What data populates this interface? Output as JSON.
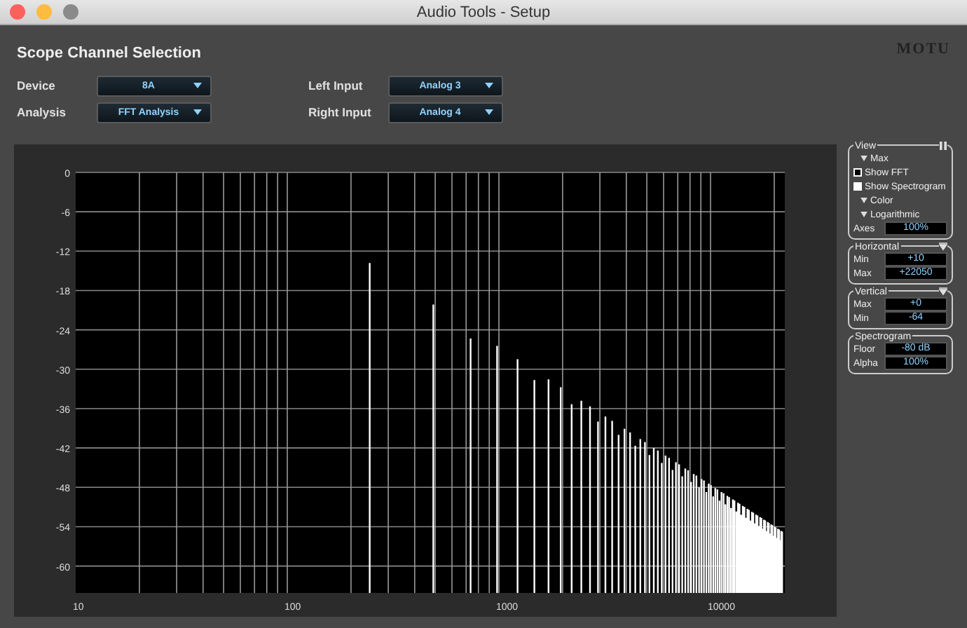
{
  "window": {
    "title": "Audio Tools - Setup"
  },
  "header": {
    "title": "Scope Channel Selection",
    "brand": "MOTU"
  },
  "selectors": [
    {
      "label": "Device",
      "value": "8A"
    },
    {
      "label": "Left Input",
      "value": "Analog 3"
    },
    {
      "label": "Analysis",
      "value": "FFT Analysis"
    },
    {
      "label": "Right Input",
      "value": "Analog 4"
    }
  ],
  "spectrum": {
    "y_axis_labels": [
      "0",
      "-6",
      "-12",
      "-18",
      "-24",
      "-30",
      "-36",
      "-42",
      "-48",
      "-54",
      "-60"
    ],
    "x_axis_labels": [
      "10",
      "100",
      "1000",
      "10000"
    ]
  },
  "side_panel": [
    {
      "title": "View",
      "kind": "pausable",
      "items": [
        {
          "kind": "disclosure",
          "label": "Max"
        },
        {
          "kind": "checkbox",
          "label": "Show FFT",
          "checked": true
        },
        {
          "kind": "checkbox",
          "label": "Show Spectrogram",
          "checked": false
        },
        {
          "kind": "disclosure",
          "label": "Color"
        },
        {
          "kind": "disclosure",
          "label": "Logarithmic"
        },
        {
          "kind": "field",
          "label": "Axes",
          "value": "100%"
        }
      ]
    },
    {
      "title": "Horizontal",
      "kind": "menu",
      "items": [
        {
          "kind": "field",
          "label": "Min",
          "value": "+10"
        },
        {
          "kind": "field",
          "label": "Max",
          "value": "+22050"
        }
      ]
    },
    {
      "title": "Vertical",
      "kind": "menu",
      "items": [
        {
          "kind": "field",
          "label": "Max",
          "value": "+0"
        },
        {
          "kind": "field",
          "label": "Min",
          "value": "-64"
        }
      ]
    },
    {
      "title": "Spectrogram",
      "kind": "plain",
      "items": [
        {
          "kind": "field",
          "label": "Floor",
          "value": "-80 dB"
        },
        {
          "kind": "field",
          "label": "Alpha",
          "value": "100%"
        }
      ]
    }
  ]
}
